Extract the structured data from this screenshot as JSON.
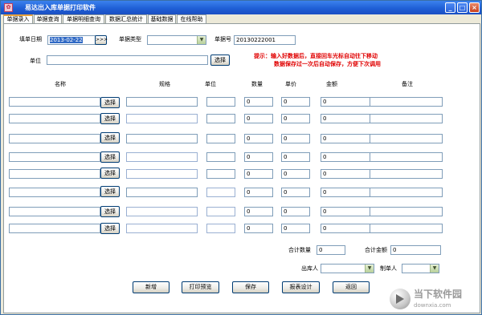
{
  "window": {
    "title": "易达出入库单据打印软件",
    "minimize": "_",
    "maximize": "□",
    "close": "×",
    "app_icon": "app-icon"
  },
  "tabs": [
    "单据录入",
    "单据查询",
    "单据明细查询",
    "数据汇总统计",
    "基础数据",
    "在线帮助"
  ],
  "header": {
    "date_label": "填单日期",
    "date_value": "2013-02-22",
    "date_btn": ">>>",
    "type_label": "单据类型",
    "type_value": "",
    "number_label": "单据号",
    "number_value": "20130222001",
    "unit_label": "单位",
    "unit_value": "",
    "select_label": "选择"
  },
  "hint": {
    "line1": "提示：输入好数据后，直接回车光标自动往下移动",
    "line2": "数据保存过一次后自动保存，方便下次调用"
  },
  "table": {
    "columns": [
      "名称",
      "规格",
      "单位",
      "数量",
      "单价",
      "金额",
      "备注"
    ],
    "select_label": "选择",
    "rows": [
      {
        "name": "",
        "spec": "",
        "unit": "",
        "qty": "0",
        "price": "0",
        "amount": "0",
        "note": ""
      },
      {
        "name": "",
        "spec": "",
        "unit": "",
        "qty": "0",
        "price": "0",
        "amount": "0",
        "note": ""
      },
      {
        "name": "",
        "spec": "",
        "unit": "",
        "qty": "0",
        "price": "0",
        "amount": "0",
        "note": ""
      },
      {
        "name": "",
        "spec": "",
        "unit": "",
        "qty": "0",
        "price": "0",
        "amount": "0",
        "note": ""
      },
      {
        "name": "",
        "spec": "",
        "unit": "",
        "qty": "0",
        "price": "0",
        "amount": "0",
        "note": ""
      },
      {
        "name": "",
        "spec": "",
        "unit": "",
        "qty": "0",
        "price": "0",
        "amount": "0",
        "note": ""
      },
      {
        "name": "",
        "spec": "",
        "unit": "",
        "qty": "0",
        "price": "0",
        "amount": "0",
        "note": ""
      },
      {
        "name": "",
        "spec": "",
        "unit": "",
        "qty": "0",
        "price": "0",
        "amount": "0",
        "note": ""
      }
    ]
  },
  "totals": {
    "qty_label": "合计数量",
    "qty_value": "0",
    "amount_label": "合计金额",
    "amount_value": "0"
  },
  "people": {
    "out_label": "出库人",
    "out_value": "",
    "maker_label": "制单人",
    "maker_value": ""
  },
  "actions": [
    "新增",
    "打印预览",
    "保存",
    "报表设计",
    "返回"
  ],
  "watermark": {
    "name": "当下软件园",
    "domain": "downxia.com"
  },
  "colors": {
    "titlebar": "#1f5fd6",
    "hint": "#e00000",
    "selection": "#316ac5",
    "tab_accent": "#e8a23c"
  }
}
